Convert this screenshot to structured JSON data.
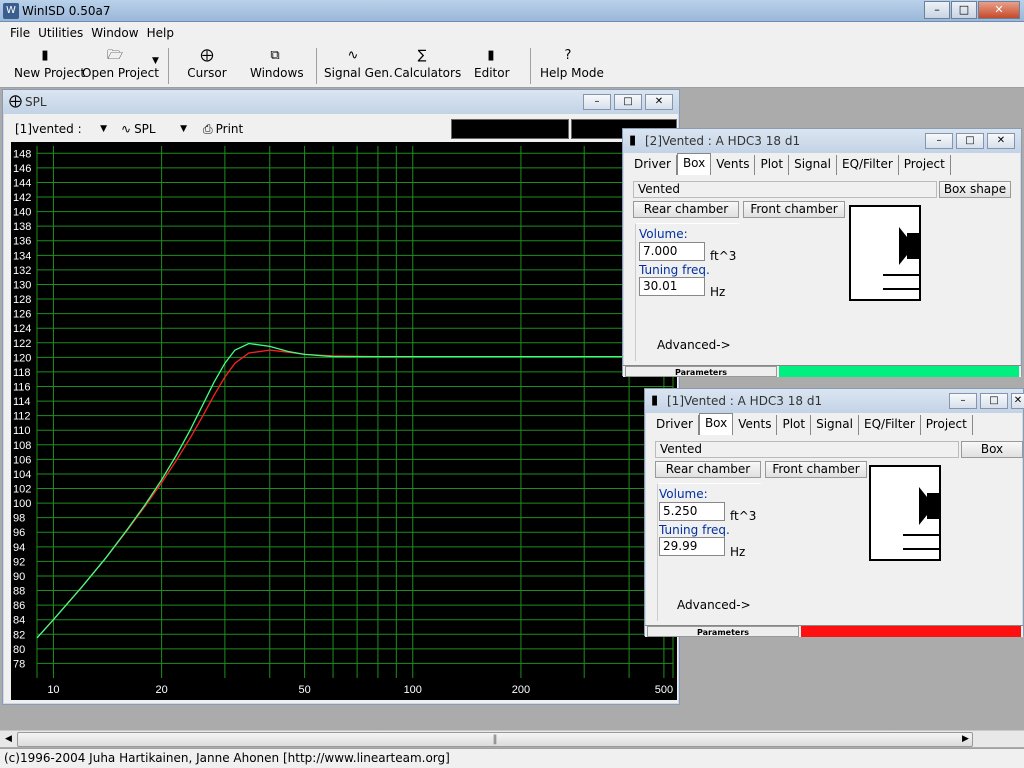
{
  "app": {
    "title": "WinISD 0.50a7"
  },
  "menu": [
    "File",
    "Utilities",
    "Window",
    "Help"
  ],
  "toolbar": {
    "new_project": "New Project",
    "open_project": "Open Project",
    "cursor": "Cursor",
    "windows": "Windows",
    "signal_gen": "Signal Gen.",
    "calculators": "Calculators",
    "editor": "Editor",
    "help_mode": "Help Mode"
  },
  "spl_window": {
    "title": "SPL",
    "project_select": "[1]vented :",
    "graph_select": "SPL",
    "print_label": "Print"
  },
  "chart_data": {
    "type": "line",
    "xscale": "log",
    "xlim": [
      9,
      530
    ],
    "ylim": [
      76,
      149
    ],
    "x_ticks": [
      10,
      20,
      50,
      100,
      200,
      500
    ],
    "y_ticks": [
      78,
      80,
      82,
      84,
      86,
      88,
      90,
      92,
      94,
      96,
      98,
      100,
      102,
      104,
      106,
      108,
      110,
      112,
      114,
      116,
      118,
      120,
      122,
      124,
      126,
      128,
      130,
      132,
      134,
      136,
      138,
      140,
      142,
      144,
      146,
      148
    ],
    "grid": true,
    "colors": {
      "background": "#000000",
      "grid": "#1e8e1e",
      "labels": "#ffffff"
    },
    "series": [
      {
        "color": "#40ff80",
        "x": [
          9,
          10,
          12,
          14,
          16,
          18,
          20,
          22,
          24,
          26,
          28,
          30,
          32,
          35,
          40,
          45,
          50,
          60,
          80,
          100,
          150,
          200,
          300,
          500
        ],
        "y": [
          81.5,
          84,
          88.5,
          92.5,
          96.3,
          99.8,
          103.2,
          106.6,
          110,
          113.4,
          116.6,
          119.2,
          121,
          121.9,
          121.5,
          120.8,
          120.4,
          120.1,
          120.1,
          120.1,
          120.1,
          120.1,
          120.1,
          120.1
        ]
      },
      {
        "color": "#ff2020",
        "x": [
          9,
          10,
          12,
          14,
          16,
          18,
          20,
          22,
          24,
          26,
          28,
          30,
          32,
          35,
          40,
          45,
          50,
          60,
          80,
          100
        ],
        "y": [
          81.5,
          84,
          88.5,
          92.5,
          96.2,
          99.6,
          102.8,
          105.9,
          108.9,
          111.9,
          114.8,
          117.3,
          119.2,
          120.6,
          121,
          120.7,
          120.4,
          120.2,
          120.1,
          120.1
        ]
      }
    ]
  },
  "vented2": {
    "title": "[2]Vented : A HDC3 18 d1",
    "tabs": [
      "Driver",
      "Box",
      "Vents",
      "Plot",
      "Signal",
      "EQ/Filter",
      "Project"
    ],
    "box_type": "Vented",
    "box_shape_btn": "Box shape",
    "rear_chamber": "Rear chamber",
    "front_chamber": "Front chamber",
    "volume_label": "Volume:",
    "volume_value": "7.000",
    "volume_unit": "ft^3",
    "tuning_label": "Tuning freq.",
    "tuning_value": "30.01",
    "tuning_unit": "Hz",
    "advanced": "Advanced->",
    "status_label": "Parameters",
    "status_color": "#00f080"
  },
  "vented1": {
    "title": "[1]Vented : A HDC3 18 d1",
    "tabs": [
      "Driver",
      "Box",
      "Vents",
      "Plot",
      "Signal",
      "EQ/Filter",
      "Project"
    ],
    "box_type": "Vented",
    "box_shape_btn": "Box shape",
    "rear_chamber": "Rear chamber",
    "front_chamber": "Front chamber",
    "volume_label": "Volume:",
    "volume_value": "5.250",
    "volume_unit": "ft^3",
    "tuning_label": "Tuning freq.",
    "tuning_value": "29.99",
    "tuning_unit": "Hz",
    "advanced": "Advanced->",
    "status_label": "Parameters",
    "status_color": "#ff1010"
  },
  "footer": {
    "copyright": "(c)1996-2004 Juha Hartikainen, Janne Ahonen [http://www.linearteam.org]"
  }
}
